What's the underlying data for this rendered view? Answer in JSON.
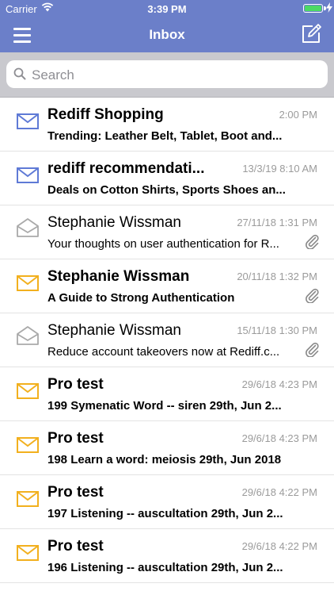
{
  "status_bar": {
    "carrier": "Carrier",
    "time": "3:39 PM"
  },
  "nav": {
    "title": "Inbox",
    "menu_icon": "hamburger-menu-icon",
    "compose_icon": "compose-icon"
  },
  "search": {
    "placeholder": "Search",
    "value": ""
  },
  "colors": {
    "nav_background": "#6b7fc9",
    "unread_envelope_blue": "#5f7ad6",
    "unread_envelope_yellow": "#f2b01e",
    "read_envelope_gray": "#a9a9a9",
    "date_text": "#9b9b9b"
  },
  "emails": [
    {
      "sender": "Rediff Shopping",
      "date": "2:00 PM",
      "preview": "Trending:  Leather Belt, Tablet, Boot and...",
      "unread": true,
      "envelope": "blue",
      "attachment": false
    },
    {
      "sender": "rediff recommendati...",
      "date": "13/3/19 8:10 AM",
      "preview": "Deals on Cotton Shirts, Sports Shoes an...",
      "unread": true,
      "envelope": "blue",
      "attachment": false
    },
    {
      "sender": "Stephanie Wissman",
      "date": "27/11/18 1:31 PM",
      "preview": "Your thoughts on user authentication for R...",
      "unread": false,
      "envelope": "open",
      "attachment": true
    },
    {
      "sender": "Stephanie Wissman",
      "date": "20/11/18 1:32 PM",
      "preview": "A Guide to Strong Authentication",
      "unread": true,
      "envelope": "yellow",
      "attachment": true
    },
    {
      "sender": "Stephanie Wissman",
      "date": "15/11/18 1:30 PM",
      "preview": "Reduce account takeovers now at Rediff.c...",
      "unread": false,
      "envelope": "open",
      "attachment": true
    },
    {
      "sender": "Pro test",
      "date": "29/6/18 4:23 PM",
      "preview": "199 Symenatic Word -- siren 29th, Jun 2...",
      "unread": true,
      "envelope": "yellow",
      "attachment": false
    },
    {
      "sender": "Pro test",
      "date": "29/6/18 4:23 PM",
      "preview": "198 Learn a word: meiosis 29th, Jun 2018",
      "unread": true,
      "envelope": "yellow",
      "attachment": false
    },
    {
      "sender": "Pro test",
      "date": "29/6/18 4:22 PM",
      "preview": "197 Listening -- auscultation 29th, Jun 2...",
      "unread": true,
      "envelope": "yellow",
      "attachment": false
    },
    {
      "sender": "Pro test",
      "date": "29/6/18 4:22 PM",
      "preview": "196 Listening -- auscultation 29th, Jun 2...",
      "unread": true,
      "envelope": "yellow",
      "attachment": false
    }
  ]
}
